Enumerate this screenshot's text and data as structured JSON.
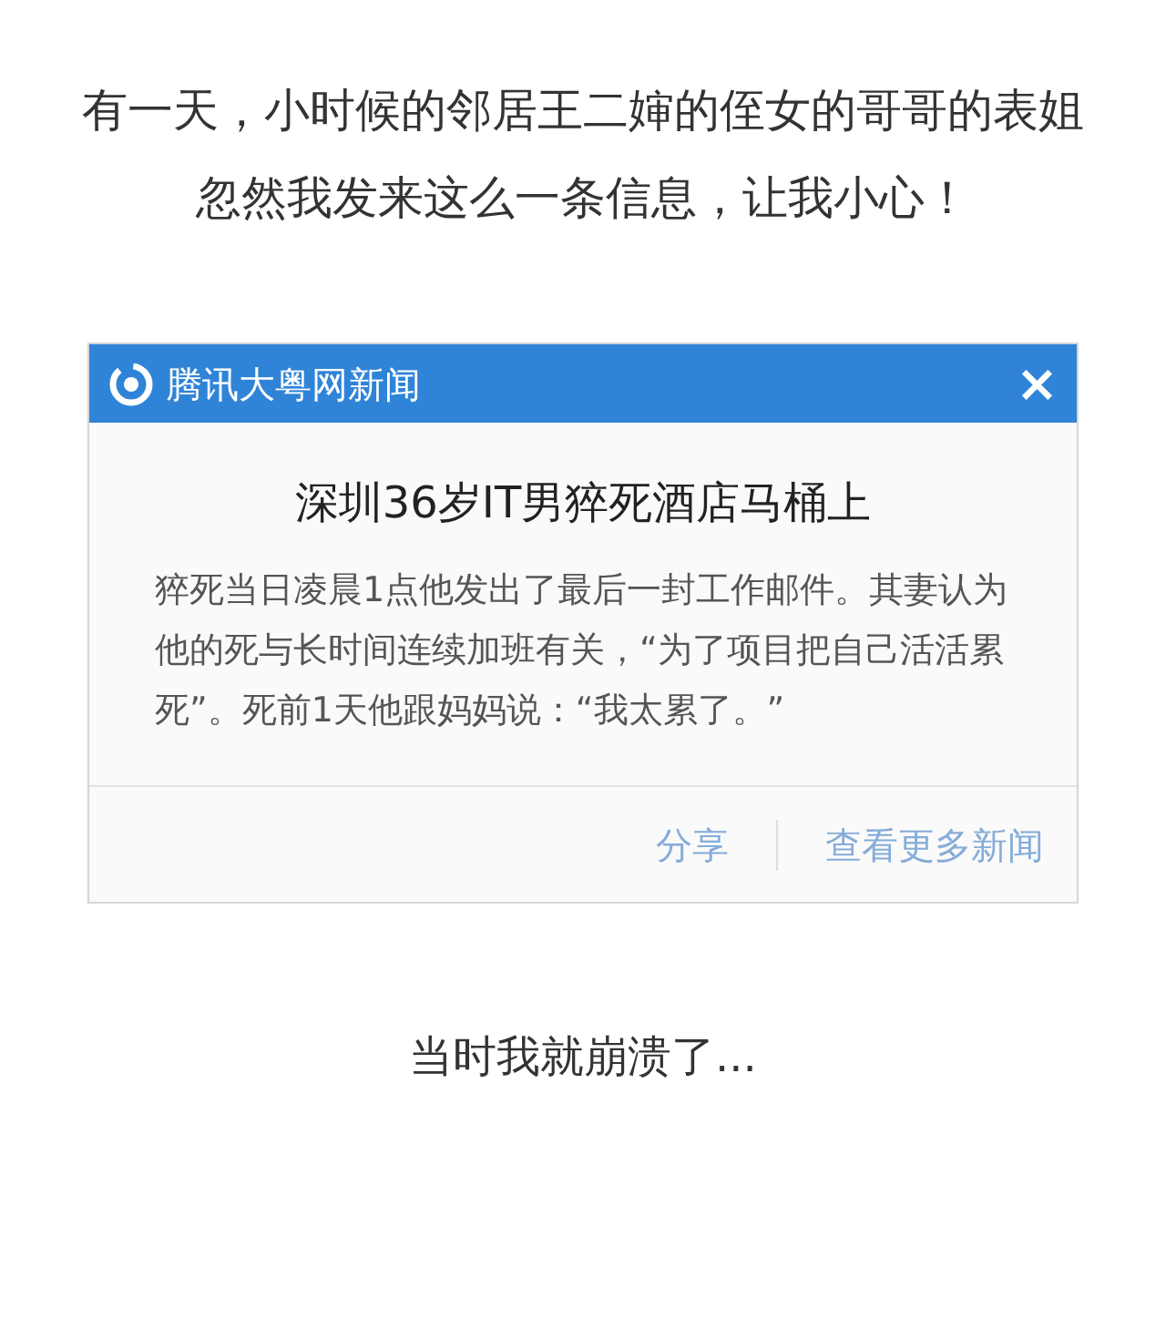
{
  "intro_lines": [
    "有一天，小时候的邻居王二婶的侄女的哥哥的表姐",
    "忽然我发来这么一条信息，让我小心！"
  ],
  "popup": {
    "source": "腾讯大粤网新闻",
    "close": "×",
    "headline": "深圳36岁IT男猝死酒店马桶上",
    "body": "猝死当日凌晨1点他发出了最后一封工作邮件。其妻认为他的死与长时间连续加班有关，“为了项目把自己活活累死”。死前1天他跟妈妈说：“我太累了。”",
    "actions": [
      "分享",
      "查看更多新闻"
    ]
  },
  "outro": "当时我就崩溃了..."
}
